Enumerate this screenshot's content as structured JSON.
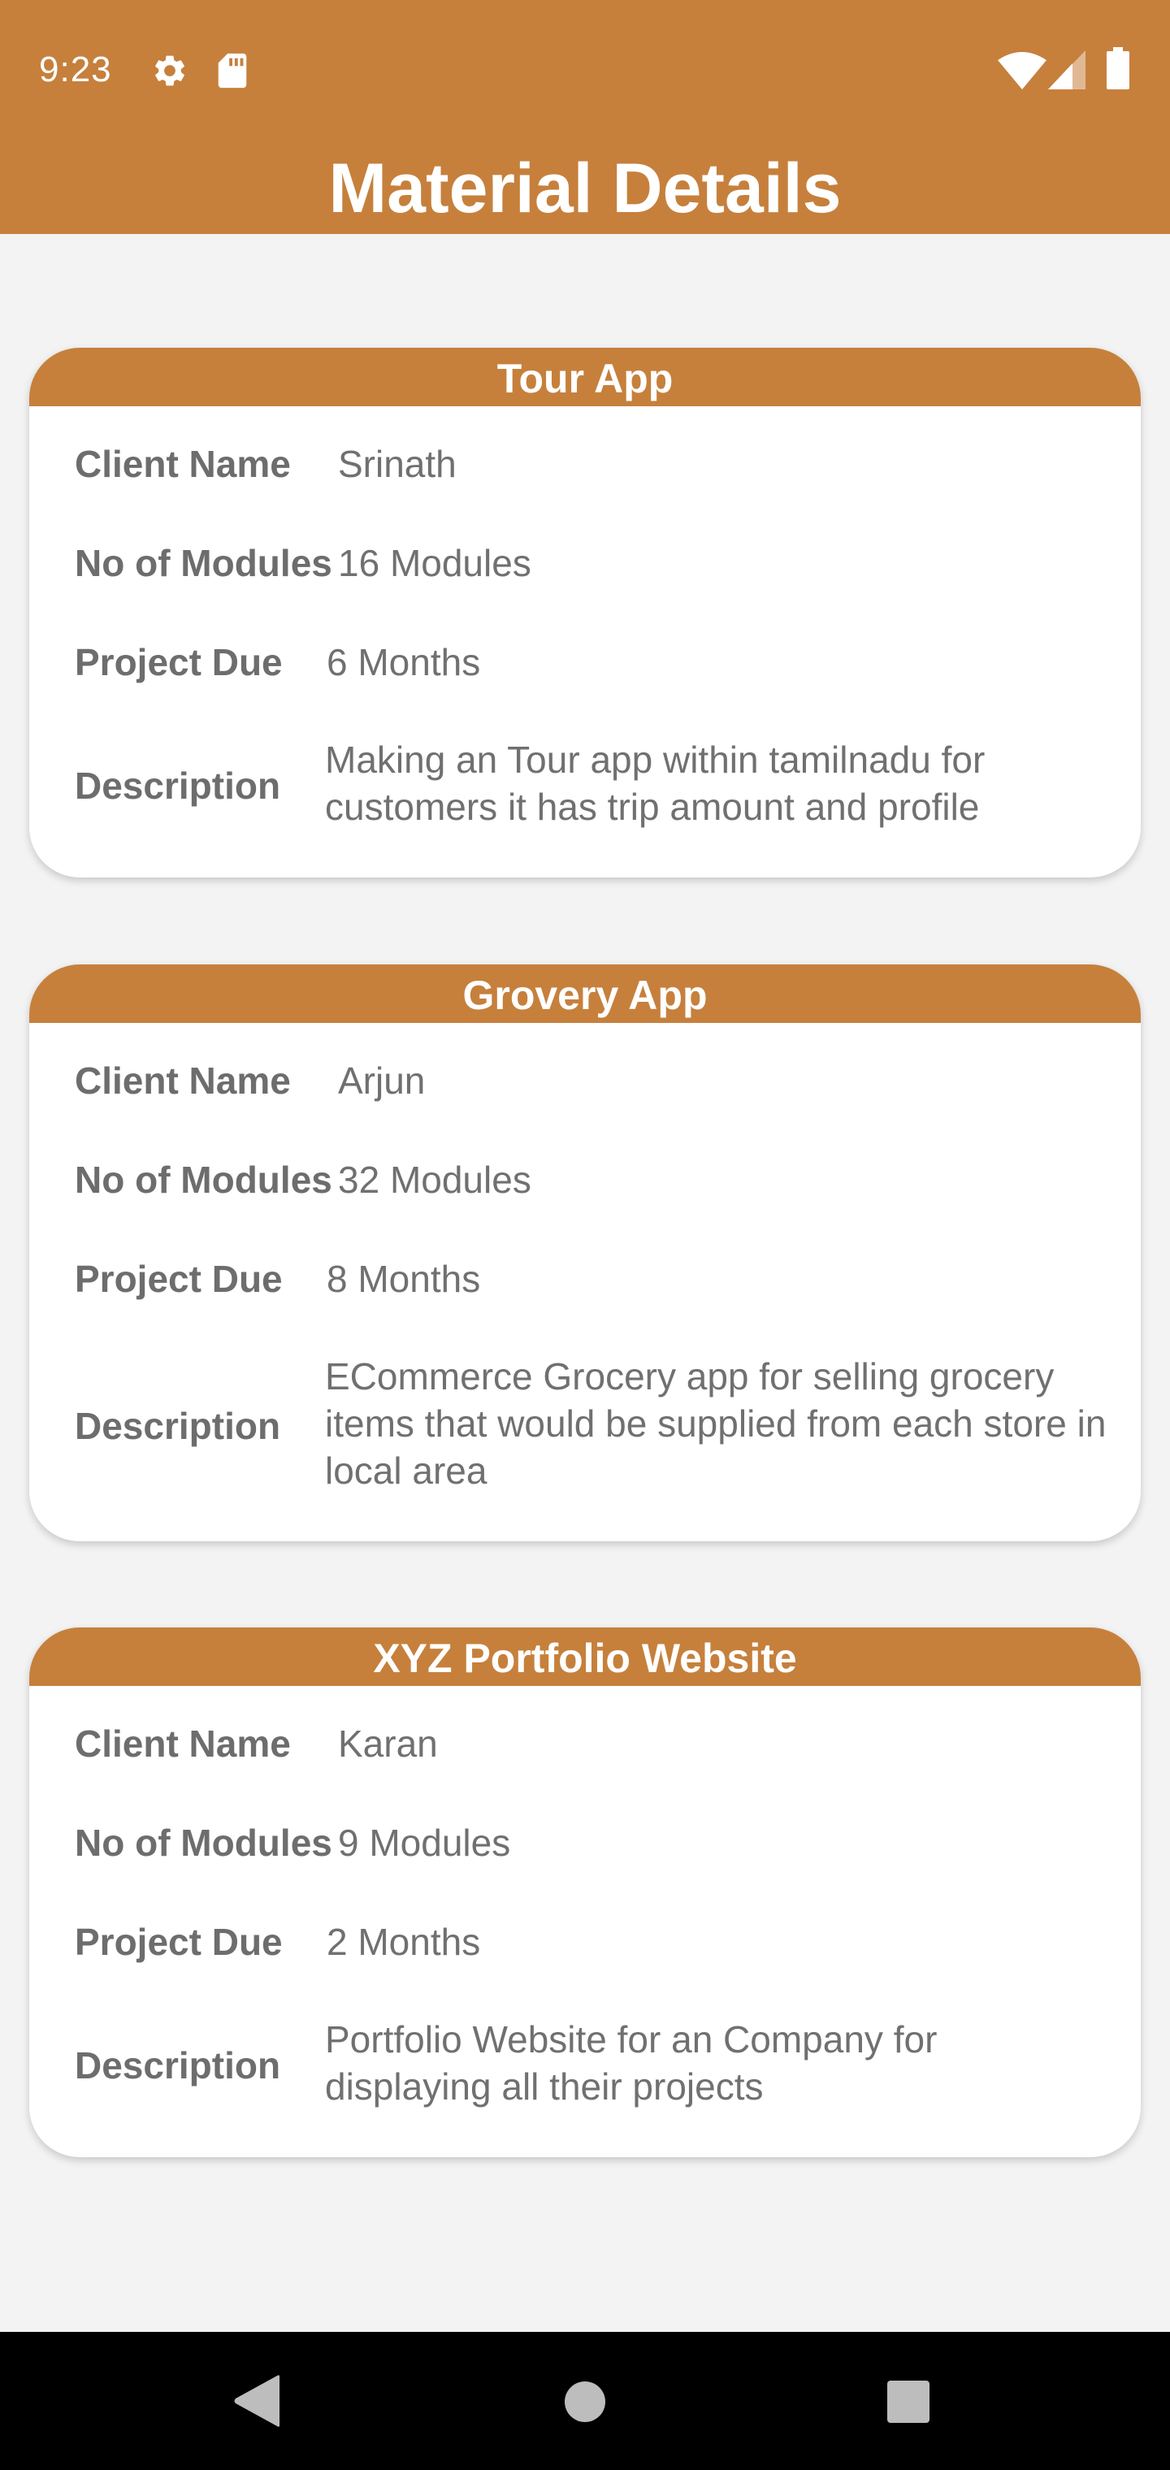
{
  "status_bar": {
    "time": "9:23",
    "icons": [
      "gear-icon",
      "sd-card-icon",
      "wifi-icon",
      "cellular-signal-icon",
      "battery-icon"
    ]
  },
  "header": {
    "title": "Material Details",
    "color": "#c6803c"
  },
  "projects": [
    {
      "title": "Tour App",
      "client_label": "Client Name",
      "client": "Srinath",
      "modules_label": "No of Modules",
      "modules": "16 Modules",
      "due_label": "Project Due",
      "due": "6 Months",
      "description_label": "Description",
      "description": "Making an Tour app within tamilnadu for customers it has trip amount and profile"
    },
    {
      "title": "Grovery App",
      "client_label": "Client Name",
      "client": "Arjun",
      "modules_label": "No of Modules",
      "modules": "32 Modules",
      "due_label": "Project Due",
      "due": "8 Months",
      "description_label": "Description",
      "description": "ECommerce Grocery app for selling grocery items that would be supplied from each store in local area"
    },
    {
      "title": "XYZ Portfolio Website",
      "client_label": "Client Name",
      "client": "Karan",
      "modules_label": "No of Modules",
      "modules": "9 Modules",
      "due_label": "Project Due",
      "due": "2 Months",
      "description_label": "Description",
      "description": "Portfolio Website for an Company for displaying all their projects"
    }
  ],
  "nav_bar": {
    "buttons": [
      "back-icon",
      "home-icon",
      "recents-icon"
    ]
  }
}
